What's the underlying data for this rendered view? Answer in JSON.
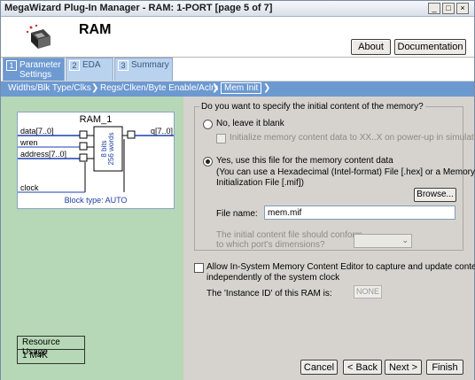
{
  "window": {
    "title": "MegaWizard Plug-In Manager - RAM: 1-PORT [page 5 of 7]",
    "buttons": {
      "minimize": "_",
      "maximize": "□",
      "close": "×"
    }
  },
  "header": {
    "title": "RAM",
    "about_label": "About",
    "documentation_label": "Documentation"
  },
  "tabs": [
    {
      "number": "1",
      "label_line1": "Parameter",
      "label_line2": "Settings"
    },
    {
      "number": "2",
      "label_line1": "EDA",
      "label_line2": ""
    },
    {
      "number": "3",
      "label_line1": "Summary",
      "label_line2": ""
    }
  ],
  "breadcrumb": {
    "items": [
      "Widths/Blk Type/Clks",
      "Regs/Clken/Byte Enable/Aclrs",
      "Mem Init"
    ]
  },
  "diagram": {
    "title": "RAM_1",
    "ports": {
      "data": "data[7..0]",
      "wren": "wren",
      "address": "address[7..0]",
      "clock": "clock",
      "q": "q[7..0]"
    },
    "mem_text1": "8 bits",
    "mem_text2": "256 words",
    "block_type": "Block type: AUTO"
  },
  "resource": {
    "header": "Resource Usage",
    "value": "1 M4K"
  },
  "init_group": {
    "question": "Do you want to specify the initial content of the memory?",
    "option_blank": "No, leave it blank",
    "option_blank_sub": "Initialize memory content data to XX..X on power-up in simulation",
    "option_file_line1": "Yes, use this file for the memory content data",
    "option_file_line2": "(You can use a Hexadecimal (Intel-format) File [.hex] or a Memory",
    "option_file_line3": "Initialization File [.mif])",
    "browse_label": "Browse...",
    "file_name_label": "File name:",
    "file_name_value": "mem.mif",
    "conform_line1": "The initial content file should conform",
    "conform_line2": "to which port's dimensions?",
    "conform_value": ""
  },
  "insystem": {
    "line1": "Allow In-System Memory Content Editor to capture and update content",
    "line2": "independently of the system clock",
    "instance_label": "The 'Instance ID' of this RAM is:",
    "instance_value": "NONE"
  },
  "footer": {
    "cancel": "Cancel",
    "back": "< Back",
    "next": "Next >",
    "finish": "Finish"
  },
  "colors": {
    "tab_active": "#6e9ad2",
    "tab_inactive": "#b9d2ee",
    "left_panel": "#b6d8b6",
    "crumb_bar": "#6d99d1"
  }
}
